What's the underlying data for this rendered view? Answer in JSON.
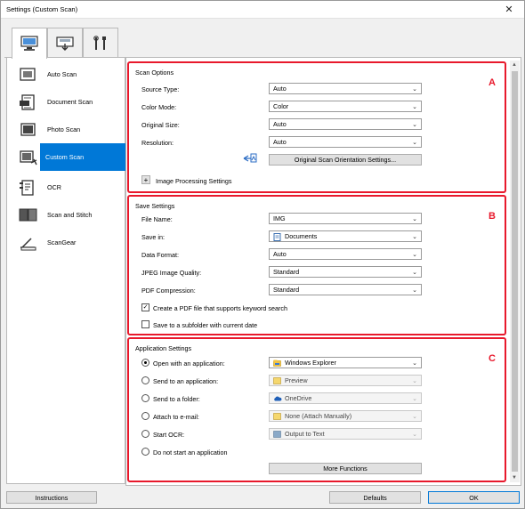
{
  "window": {
    "title": "Settings (Custom Scan)",
    "close_glyph": "✕"
  },
  "top_tabs": [
    {
      "icon": "scan-from-computer-icon",
      "active": true
    },
    {
      "icon": "scan-from-operation-panel-icon",
      "active": false
    },
    {
      "icon": "general-settings-tools-icon",
      "active": false
    }
  ],
  "sidebar": {
    "items": [
      {
        "label": "Auto Scan",
        "icon": "auto-scan-icon"
      },
      {
        "label": "Document Scan",
        "icon": "document-scan-icon"
      },
      {
        "label": "Photo Scan",
        "icon": "photo-scan-icon"
      },
      {
        "label": "Custom Scan",
        "icon": "custom-scan-icon",
        "active": true
      },
      {
        "label": "OCR",
        "icon": "ocr-icon"
      },
      {
        "label": "Scan and Stitch",
        "icon": "scan-and-stitch-icon"
      },
      {
        "label": "ScanGear",
        "icon": "scangear-icon"
      }
    ]
  },
  "scan_options": {
    "title": "Scan Options",
    "letter": "A",
    "source_type": {
      "label": "Source Type:",
      "value": "Auto"
    },
    "color_mode": {
      "label": "Color Mode:",
      "value": "Color"
    },
    "original_size": {
      "label": "Original Size:",
      "value": "Auto"
    },
    "resolution": {
      "label": "Resolution:",
      "value": "Auto"
    },
    "orientation_button": "Original Scan Orientation Settings...",
    "expand_glyph": "+",
    "image_processing": "Image Processing Settings"
  },
  "save_settings": {
    "title": "Save Settings",
    "letter": "B",
    "file_name": {
      "label": "File Name:",
      "value": "IMG"
    },
    "save_in": {
      "label": "Save in:",
      "value": "Documents"
    },
    "data_format": {
      "label": "Data Format:",
      "value": "Auto"
    },
    "jpeg_quality": {
      "label": "JPEG Image Quality:",
      "value": "Standard"
    },
    "pdf_compression": {
      "label": "PDF Compression:",
      "value": "Standard"
    },
    "create_pdf_keyword": {
      "label": "Create a PDF file that supports keyword search",
      "checked": true,
      "check_glyph": "✓"
    },
    "save_subfolder": {
      "label": "Save to a subfolder with current date",
      "checked": false
    }
  },
  "application_settings": {
    "title": "Application Settings",
    "letter": "C",
    "open_with_app": {
      "label": "Open with an application:",
      "value": "Windows Explorer",
      "selected": true
    },
    "send_to_app": {
      "label": "Send to an application:",
      "value": "Preview",
      "selected": false
    },
    "send_to_folder": {
      "label": "Send to a folder:",
      "value": "OneDrive",
      "selected": false
    },
    "attach_email": {
      "label": "Attach to e-mail:",
      "value": "None (Attach Manually)",
      "selected": false
    },
    "start_ocr": {
      "label": "Start OCR:",
      "value": "Output to Text",
      "selected": false
    },
    "no_app": {
      "label": "Do not start an application",
      "selected": false
    },
    "more_functions": "More Functions"
  },
  "footer": {
    "instructions": "Instructions",
    "defaults": "Defaults",
    "ok": "OK"
  },
  "colors": {
    "highlight_red": "#e8192c",
    "selection_blue": "#0078d7"
  }
}
